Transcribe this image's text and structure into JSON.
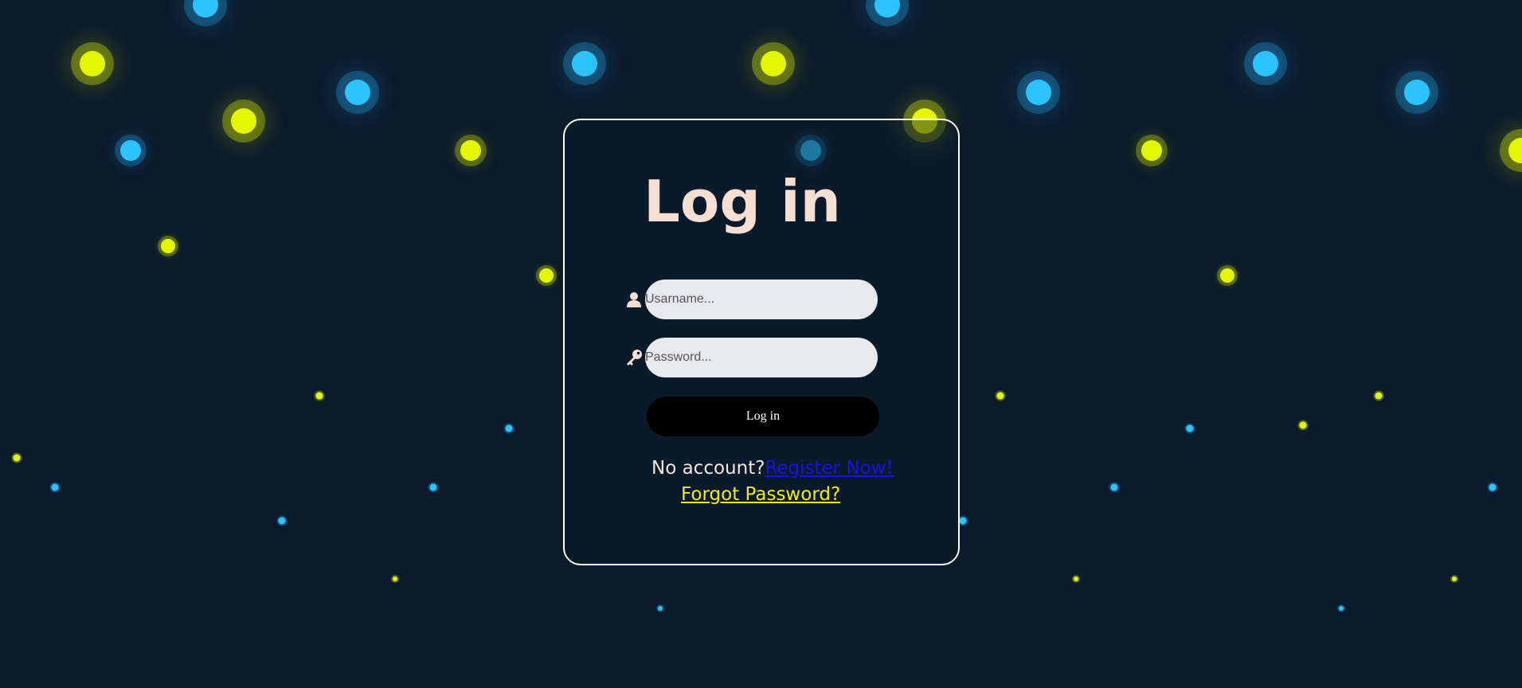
{
  "colors": {
    "background": "#0c1a2b",
    "dot_yellow": "#e4f700",
    "dot_blue": "#2cc4ff",
    "title": "#f5dfd3",
    "register_link": "#1a10e6",
    "forgot_link": "#f0f000",
    "button": "#000000"
  },
  "login": {
    "title": "Log in",
    "username_placeholder": "Usarname...",
    "password_placeholder": "Password...",
    "username_icon": "user-icon",
    "password_icon": "key-icon",
    "button_label": "Log in",
    "no_account_text": "No account?",
    "register_link": "Register Now!",
    "forgot_link": "Forgot Password?"
  }
}
